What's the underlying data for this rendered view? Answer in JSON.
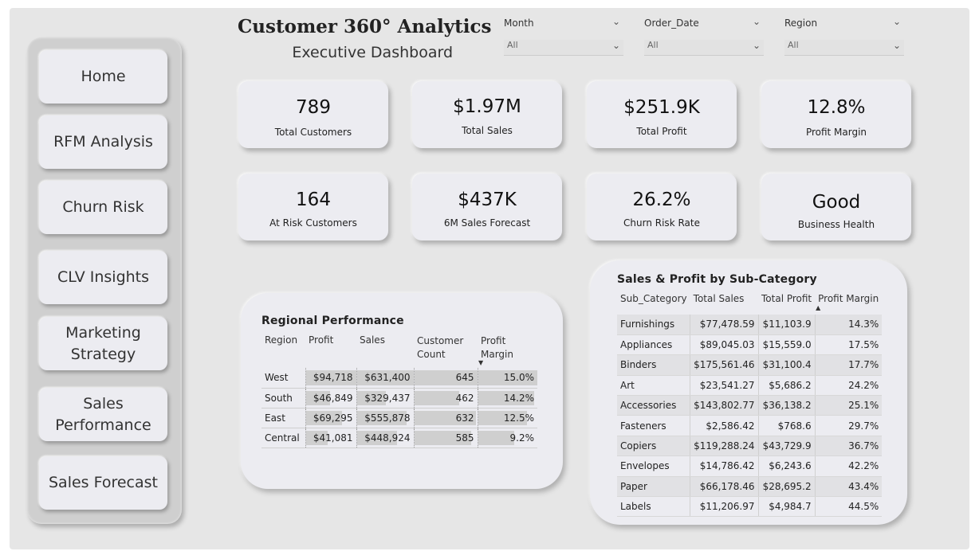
{
  "header": {
    "title": "Customer 360°  Analytics",
    "subtitle": "Executive Dashboard"
  },
  "slicers": [
    {
      "label": "Month",
      "value": "All"
    },
    {
      "label": "Order_Date",
      "value": "All"
    },
    {
      "label": "Region",
      "value": "All"
    }
  ],
  "nav": [
    "Home",
    "RFM Analysis",
    "Churn Risk",
    "CLV Insights",
    "Marketing Strategy",
    "Sales Performance",
    "Sales Forecast"
  ],
  "kpis": [
    {
      "value": "789",
      "label": "Total Customers"
    },
    {
      "value": "$1.97M",
      "label": "Total Sales"
    },
    {
      "value": "$251.9K",
      "label": "Total Profit"
    },
    {
      "value": "12.8%",
      "label": "Profit Margin"
    },
    {
      "value": "164",
      "label": "At Risk Customers"
    },
    {
      "value": "$437K",
      "label": "6M Sales Forecast"
    },
    {
      "value": "26.2%",
      "label": "Churn Risk Rate"
    },
    {
      "value": "Good",
      "label": "Business Health"
    }
  ],
  "regional": {
    "title": "Regional Performance",
    "columns": [
      "Region",
      "Profit",
      "Sales",
      "Customer Count",
      "Profit Margin"
    ],
    "sort_icon": "sort-descending-icon",
    "rows": [
      {
        "region": "West",
        "profit": "$94,718",
        "sales": "$631,400",
        "customers": "645",
        "margin": "15.0%",
        "profit_frac": 1.0,
        "sales_frac": 1.0,
        "cust_frac": 1.0,
        "margin_frac": 1.0
      },
      {
        "region": "South",
        "profit": "$46,849",
        "sales": "$329,437",
        "customers": "462",
        "margin": "14.2%",
        "profit_frac": 0.49,
        "sales_frac": 0.52,
        "cust_frac": 0.72,
        "margin_frac": 0.95
      },
      {
        "region": "East",
        "profit": "$69,295",
        "sales": "$555,878",
        "customers": "632",
        "margin": "12.5%",
        "profit_frac": 0.73,
        "sales_frac": 0.88,
        "cust_frac": 0.98,
        "margin_frac": 0.83
      },
      {
        "region": "Central",
        "profit": "$41,081",
        "sales": "$448,924",
        "customers": "585",
        "margin": "9.2%",
        "profit_frac": 0.43,
        "sales_frac": 0.71,
        "cust_frac": 0.91,
        "margin_frac": 0.61
      }
    ]
  },
  "subcategory": {
    "title": "Sales & Profit by Sub-Category",
    "columns": [
      "Sub_Category",
      "Total Sales",
      "Total Profit",
      "Profit Margin"
    ],
    "sort_icon": "sort-ascending-icon",
    "rows": [
      {
        "name": "Furnishings",
        "sales": "$77,478.59",
        "profit": "$11,103.9",
        "margin": "14.3%"
      },
      {
        "name": "Appliances",
        "sales": "$89,045.03",
        "profit": "$15,559.0",
        "margin": "17.5%"
      },
      {
        "name": "Binders",
        "sales": "$175,561.46",
        "profit": "$31,100.4",
        "margin": "17.7%"
      },
      {
        "name": "Art",
        "sales": "$23,541.27",
        "profit": "$5,686.2",
        "margin": "24.2%"
      },
      {
        "name": "Accessories",
        "sales": "$143,802.77",
        "profit": "$36,138.2",
        "margin": "25.1%"
      },
      {
        "name": "Fasteners",
        "sales": "$2,586.42",
        "profit": "$768.6",
        "margin": "29.7%"
      },
      {
        "name": "Copiers",
        "sales": "$119,288.24",
        "profit": "$43,729.9",
        "margin": "36.7%"
      },
      {
        "name": "Envelopes",
        "sales": "$14,786.42",
        "profit": "$6,243.6",
        "margin": "42.2%"
      },
      {
        "name": "Paper",
        "sales": "$66,178.46",
        "profit": "$28,695.2",
        "margin": "43.4%"
      },
      {
        "name": "Labels",
        "sales": "$11,206.97",
        "profit": "$4,984.7",
        "margin": "44.5%"
      }
    ]
  }
}
